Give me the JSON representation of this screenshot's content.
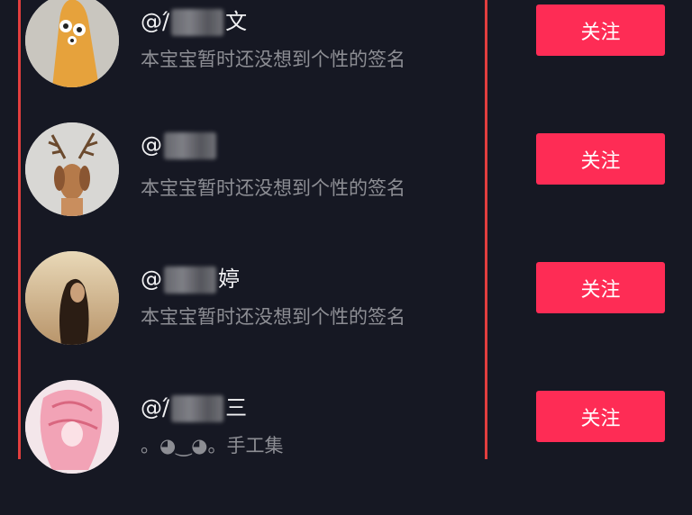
{
  "users": [
    {
      "handle_prefix": "@",
      "handle_visible_1": "/́",
      "handle_visible_2": "文",
      "bio": "本宝宝暂时还没想到个性的签名",
      "follow_label": "关注",
      "avatar_icon": "cartoon-character-avatar"
    },
    {
      "handle_prefix": "@",
      "handle_visible_1": "",
      "handle_visible_2": "",
      "bio": "本宝宝暂时还没想到个性的签名",
      "follow_label": "关注",
      "avatar_icon": "deer-dog-avatar"
    },
    {
      "handle_prefix": "@",
      "handle_visible_1": "",
      "handle_visible_2": "婷",
      "bio": "本宝宝暂时还没想到个性的签名",
      "follow_label": "关注",
      "avatar_icon": "girl-photo-avatar"
    },
    {
      "handle_prefix": "@",
      "handle_visible_1": "/́",
      "handle_visible_2": "三",
      "bio": "。◕‿◕。手工集",
      "follow_label": "关注",
      "avatar_icon": "anime-drawing-avatar"
    }
  ],
  "colors": {
    "background": "#161823",
    "follow_button": "#fe2c55",
    "frame_line": "#e23e3e"
  }
}
